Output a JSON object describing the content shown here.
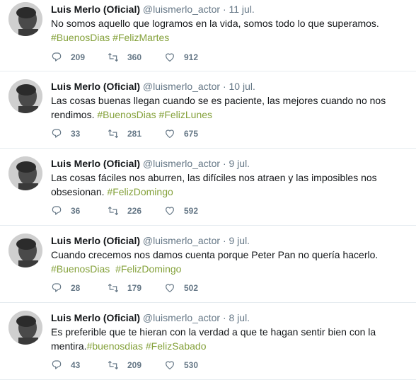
{
  "tweets": [
    {
      "name": "Luis Merlo (Oficial)",
      "handle": "@luismerlo_actor",
      "dot": "·",
      "date": "11 jul.",
      "text_lines": [
        [
          {
            "t": "No somos aquello que logramos en la vida, somos todo lo que superamos.",
            "h": false
          }
        ],
        [
          {
            "t": "#BuenosDias",
            "h": true
          },
          {
            "t": " ",
            "h": false
          },
          {
            "t": "#FelizMartes",
            "h": true
          }
        ]
      ],
      "replies": "209",
      "retweets": "360",
      "likes": "912"
    },
    {
      "name": "Luis Merlo (Oficial)",
      "handle": "@luismerlo_actor",
      "dot": "·",
      "date": "10 jul.",
      "text_lines": [
        [
          {
            "t": "Las cosas buenas llegan cuando se es paciente, las mejores cuando no nos",
            "h": false
          }
        ],
        [
          {
            "t": "rendimos. ",
            "h": false
          },
          {
            "t": "#BuenosDias",
            "h": true
          },
          {
            "t": " ",
            "h": false
          },
          {
            "t": "#FelizLunes",
            "h": true
          }
        ]
      ],
      "replies": "33",
      "retweets": "281",
      "likes": "675"
    },
    {
      "name": "Luis Merlo (Oficial)",
      "handle": "@luismerlo_actor",
      "dot": "·",
      "date": "9 jul.",
      "text_lines": [
        [
          {
            "t": "Las cosas fáciles nos aburren, las difíciles nos atraen y las imposibles nos",
            "h": false
          }
        ],
        [
          {
            "t": "obsesionan. ",
            "h": false
          },
          {
            "t": "#FelizDomingo",
            "h": true
          }
        ]
      ],
      "replies": "36",
      "retweets": "226",
      "likes": "592"
    },
    {
      "name": "Luis Merlo (Oficial)",
      "handle": "@luismerlo_actor",
      "dot": "·",
      "date": "9 jul.",
      "text_lines": [
        [
          {
            "t": "Cuando crecemos nos damos cuenta porque Peter Pan no quería hacerlo.",
            "h": false
          }
        ],
        [
          {
            "t": "#BuenosDias",
            "h": true
          },
          {
            "t": "  ",
            "h": false
          },
          {
            "t": "#FelizDomingo",
            "h": true
          }
        ]
      ],
      "replies": "28",
      "retweets": "179",
      "likes": "502"
    },
    {
      "name": "Luis Merlo (Oficial)",
      "handle": "@luismerlo_actor",
      "dot": "·",
      "date": "8 jul.",
      "text_lines": [
        [
          {
            "t": "Es preferible que te hieran con la verdad a que te hagan sentir bien con la",
            "h": false
          }
        ],
        [
          {
            "t": "mentira.",
            "h": false
          },
          {
            "t": "#buenosdias",
            "h": true
          },
          {
            "t": " ",
            "h": false
          },
          {
            "t": "#FelizSabado",
            "h": true
          }
        ]
      ],
      "replies": "43",
      "retweets": "209",
      "likes": "530"
    }
  ],
  "icons": {
    "reply": "reply-icon",
    "retweet": "retweet-icon",
    "like": "heart-icon"
  },
  "colors": {
    "hashtag": "#84a13a",
    "meta": "#657786",
    "text": "#14171a"
  }
}
